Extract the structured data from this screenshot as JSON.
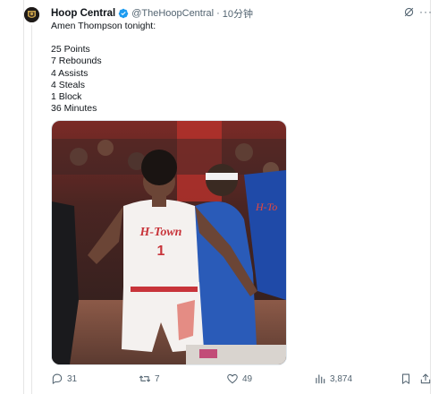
{
  "tweet": {
    "display_name": "Hoop Central",
    "handle": "@TheHoopCentral",
    "separator": "·",
    "time": "10分钟",
    "verified_color": "#1d9bf0",
    "lines": [
      "Amen Thompson tonight:",
      "",
      "25 Points",
      "7 Rebounds",
      "4 Assists",
      "4 Steals",
      "1 Block",
      "36 Minutes"
    ],
    "media": {
      "jersey_text": "H-Town",
      "jersey_number": "1",
      "opponent_jersey_text": "H-To"
    }
  },
  "actions": {
    "replies": "31",
    "retweets": "7",
    "likes": "49",
    "views": "3,874"
  },
  "icons": [
    "avatar-logo",
    "verified-badge-icon",
    "grok-icon",
    "more-icon",
    "reply-icon",
    "retweet-icon",
    "like-icon",
    "views-icon",
    "bookmark-icon",
    "share-icon"
  ]
}
